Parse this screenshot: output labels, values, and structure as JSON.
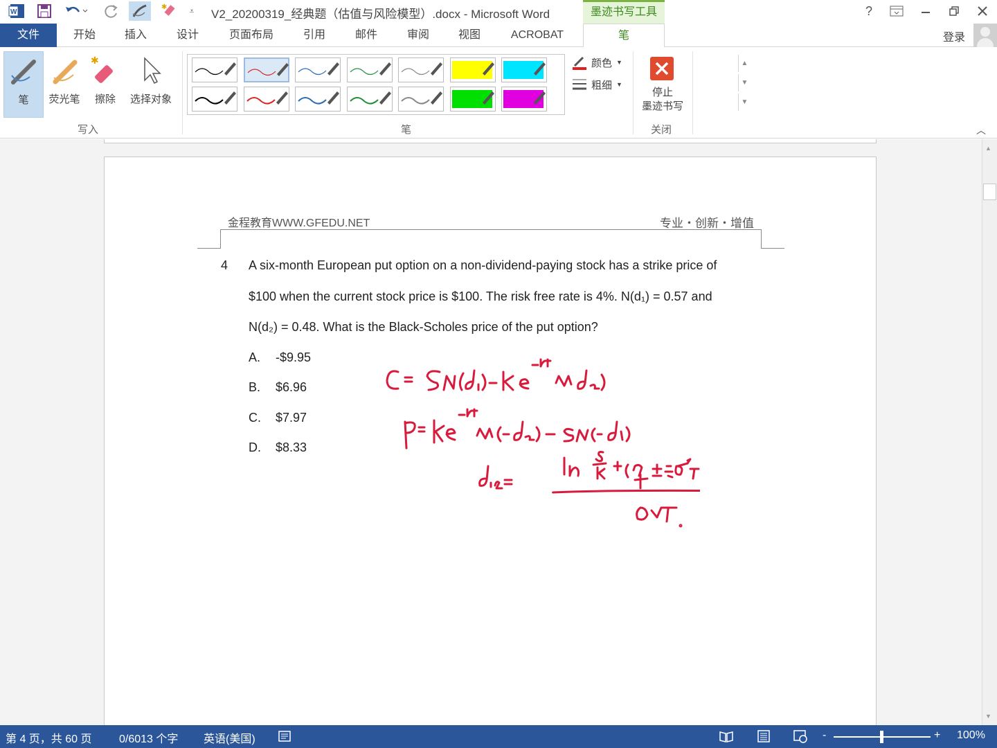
{
  "titlebar": {
    "title": "V2_20200319_经典题（估值与风险模型）.docx - Microsoft Word",
    "context_tab": "墨迹书写工具",
    "help": "?",
    "icons": [
      "word-app-icon",
      "save-icon",
      "undo-icon",
      "redo-icon",
      "pen-qat-icon",
      "highlighter-qat-icon",
      "customize-qat-icon",
      "ribbon-display-icon",
      "minimize-icon",
      "restore-icon",
      "close-icon"
    ]
  },
  "tabs": {
    "file": "文件",
    "items": [
      "开始",
      "插入",
      "设计",
      "页面布局",
      "引用",
      "邮件",
      "审阅",
      "视图",
      "ACROBAT",
      "笔"
    ],
    "login": "登录"
  },
  "ribbon": {
    "write_group": {
      "label": "写入",
      "pen": "笔",
      "highlighter": "荧光笔",
      "eraser": "擦除",
      "select": "选择对象"
    },
    "pens_group": {
      "label": "笔",
      "row1_colors": [
        "#000000",
        "#d62828",
        "#2b6cb0",
        "#1f8f3a",
        "#888888",
        "#ffff00",
        "#00e5ff"
      ],
      "row2_colors": [
        "#000000",
        "#d62828",
        "#2b6cb0",
        "#1f8f3a",
        "#888888",
        "#00e000",
        "#e000e0"
      ],
      "color": "颜色",
      "thickness": "粗细"
    },
    "close_group": {
      "label": "关闭",
      "stop_line1": "停止",
      "stop_line2": "墨迹书写"
    }
  },
  "document": {
    "header_left": "金程教育WWW.GFEDU.NET",
    "header_right": "专业・创新・增值",
    "question_number": "4",
    "question_lines": [
      "A six-month European put option on a non-dividend-paying stock has a strike price of",
      "$100 when the current stock price is $100. The risk free rate is 4%. N(d₁) = 0.57 and",
      "N(d₂) = 0.48. What is the Black-Scholes price of the put option?"
    ],
    "options": [
      {
        "letter": "A.",
        "value": "-$9.95"
      },
      {
        "letter": "B.",
        "value": "$6.96"
      },
      {
        "letter": "C.",
        "value": "$7.97"
      },
      {
        "letter": "D.",
        "value": "$8.33"
      }
    ],
    "ink_color": "#d81b3c"
  },
  "statusbar": {
    "page": "第 4 页，共 60 页",
    "words": "0/6013 个字",
    "language": "英语(美国)",
    "zoom": "100%",
    "zoom_minus": "-",
    "zoom_plus": "+"
  }
}
